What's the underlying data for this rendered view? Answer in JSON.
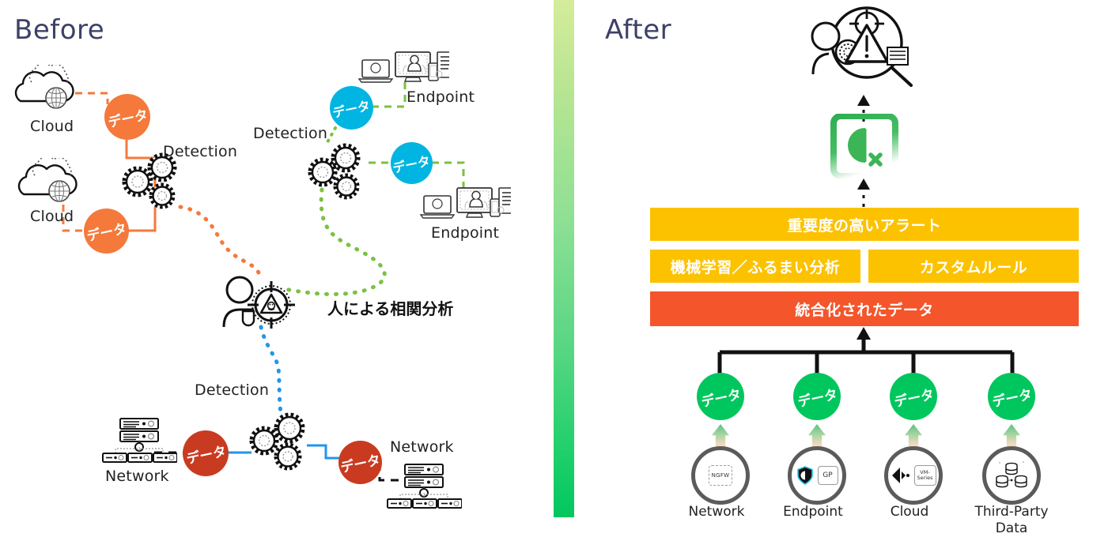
{
  "left": {
    "title": "Before",
    "analyst_note": "人による相関分析",
    "detection_labels": [
      "Detection",
      "Detection",
      "Detection"
    ],
    "data_bubble_text": "データ",
    "sources": [
      {
        "label": "Cloud",
        "icon": "cloud-icon",
        "accent": "#f4793b"
      },
      {
        "label": "Cloud",
        "icon": "cloud-icon",
        "accent": "#f4793b"
      },
      {
        "label": "Endpoint",
        "icon": "endpoint-icon",
        "accent": "#00b5e2"
      },
      {
        "label": "Endpoint",
        "icon": "endpoint-icon",
        "accent": "#00b5e2"
      },
      {
        "label": "Network",
        "icon": "network-icon",
        "accent": "#c93b21"
      },
      {
        "label": "Network",
        "icon": "network-icon",
        "accent": "#c93b21"
      }
    ],
    "analyst_icon": "analyst-threat-target-icon",
    "gears_icon": "gears-icon"
  },
  "right": {
    "title": "After",
    "investigation_icon": "threat-investigation-magnifier-icon",
    "product_icon": "cortex-xdr-logo",
    "bars": [
      {
        "text": "重要度の高いアラート",
        "color": "#fcc200"
      },
      {
        "text": "機械学習／ふるまい分析",
        "color": "#fcc200"
      },
      {
        "text": "カスタムルール",
        "color": "#fcc200"
      },
      {
        "text": "統合化されたデータ",
        "color": "#f4552b"
      }
    ],
    "data_bubble_text": "データ",
    "sources": [
      {
        "label": "Network",
        "chips": [
          "NGFW"
        ],
        "icon": "ngfw-icon"
      },
      {
        "label": "Endpoint",
        "chips": [
          "GP"
        ],
        "icon": "shield-gp-icon"
      },
      {
        "label": "Cloud",
        "chips": [
          "VM-\nSeries"
        ],
        "icon": "prisma-vmseries-icon"
      },
      {
        "label": "Third-Party\nData",
        "chips": [],
        "icon": "database-stack-icon"
      }
    ]
  },
  "colors": {
    "title": "#3d4168",
    "orange": "#f4793b",
    "cyan": "#00b5e2",
    "dark_red": "#c93b21",
    "green": "#00c65e",
    "yellow": "#fcc200",
    "red_bar": "#f4552b",
    "divider_top": "#d4ec9b",
    "divider_bottom": "#03c75e"
  }
}
